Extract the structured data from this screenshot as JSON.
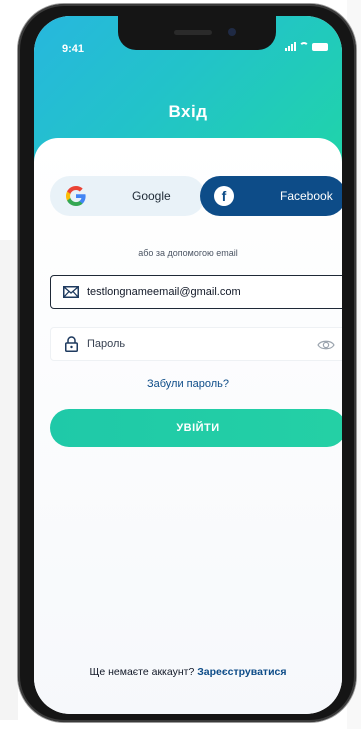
{
  "status_bar": {
    "time": "9:41"
  },
  "header": {
    "title": "Вхід"
  },
  "social": {
    "google_label": "Google",
    "facebook_label": "Facebook"
  },
  "divider_text": "або за допомогою email",
  "form": {
    "email_value": "testlongnameemail@gmail.com",
    "password_placeholder": "Пароль",
    "forgot_label": "Забули пароль?",
    "login_label": "УВІЙТИ"
  },
  "footer": {
    "prompt": "Ще немаєте аккаунт?",
    "register_label": "Зареєструватися"
  },
  "colors": {
    "primary": "#0d4c88",
    "accent": "#1fc9a8",
    "header_start": "#27b7de",
    "header_end": "#20d4a9"
  },
  "icons": [
    "google-icon",
    "facebook-icon",
    "mail-icon",
    "lock-icon",
    "eye-icon"
  ]
}
